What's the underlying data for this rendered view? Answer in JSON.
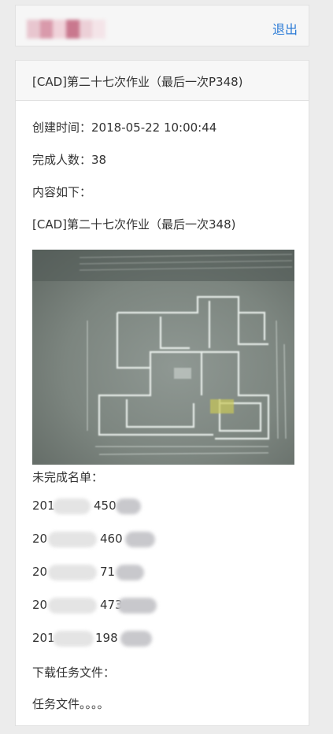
{
  "header": {
    "logout_label": "退出",
    "avatar_colors": [
      "#e8c6cf",
      "#d99aab",
      "#f0d3da",
      "#c9788e",
      "#ecd0d7",
      "#f4e4e8"
    ]
  },
  "assignment": {
    "title": "[CAD]第二十七次作业（最后一次P348)",
    "created_label": "创建时间：",
    "created_value": "2018-05-22 10:00:44",
    "completed_label": "完成人数：",
    "completed_value": "38",
    "content_label": "内容如下：",
    "content_text": "[CAD]第二十七次作业（最后一次348)",
    "image_icon": "floor-plan-photo",
    "incomplete_label": "未完成名单：",
    "incomplete_list": [
      {
        "prefix": "201",
        "mid": "450"
      },
      {
        "prefix": "20",
        "mid": "460"
      },
      {
        "prefix": "20",
        "mid": "71"
      },
      {
        "prefix": "20",
        "mid": "473"
      },
      {
        "prefix": "201",
        "mid": "198"
      }
    ],
    "download_label": "下载任务文件：",
    "download_link": "任务文件。。。。"
  }
}
